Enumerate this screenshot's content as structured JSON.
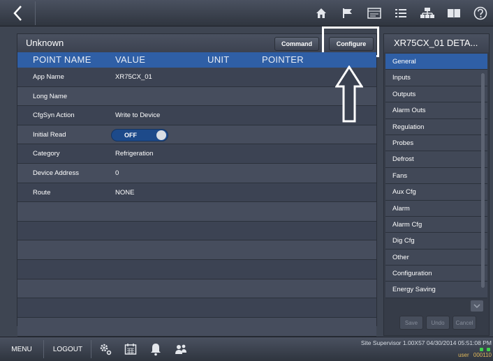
{
  "topbar": {
    "icons": [
      "home-icon",
      "flag-icon",
      "calendar-icon",
      "list-icon",
      "network-icon",
      "book-icon",
      "help-icon"
    ]
  },
  "main": {
    "title": "Unknown",
    "command_label": "Command",
    "configure_label": "Configure",
    "columns": [
      "POINT NAME",
      "VALUE",
      "UNIT",
      "POINTER"
    ],
    "rows": [
      {
        "name": "App Name",
        "value": "XR75CX_01"
      },
      {
        "name": "Long Name",
        "value": ""
      },
      {
        "name": "CfgSyn Action",
        "value": "Write to Device"
      },
      {
        "name": "Initial Read",
        "value": "OFF",
        "toggle": true
      },
      {
        "name": "Category",
        "value": "Refrigeration"
      },
      {
        "name": "Device Address",
        "value": "0"
      },
      {
        "name": "Route",
        "value": "NONE"
      }
    ],
    "empty_rows": 7
  },
  "details": {
    "title": "XR75CX_01 DETA...",
    "items": [
      "General",
      "Inputs",
      "Outputs",
      "Alarm Outs",
      "Regulation",
      "Probes",
      "Defrost",
      "Fans",
      "Aux Cfg",
      "Alarm",
      "Alarm Cfg",
      "Dig Cfg",
      "Other",
      "Configuration",
      "Energy Saving"
    ],
    "selected": "General",
    "save_label": "Save",
    "undo_label": "Undo",
    "cancel_label": "Cancel"
  },
  "bottombar": {
    "menu_label": "MENU",
    "logout_label": "LOGOUT",
    "status": "Site Supervisor 1.00X57 04/30/2014 05:51:08 PM",
    "user_label": "user",
    "user_value": "000110"
  },
  "colors": {
    "accent": "#2f5fa6",
    "highlight": "#ffffff",
    "status_ok": "#3fd04c"
  }
}
